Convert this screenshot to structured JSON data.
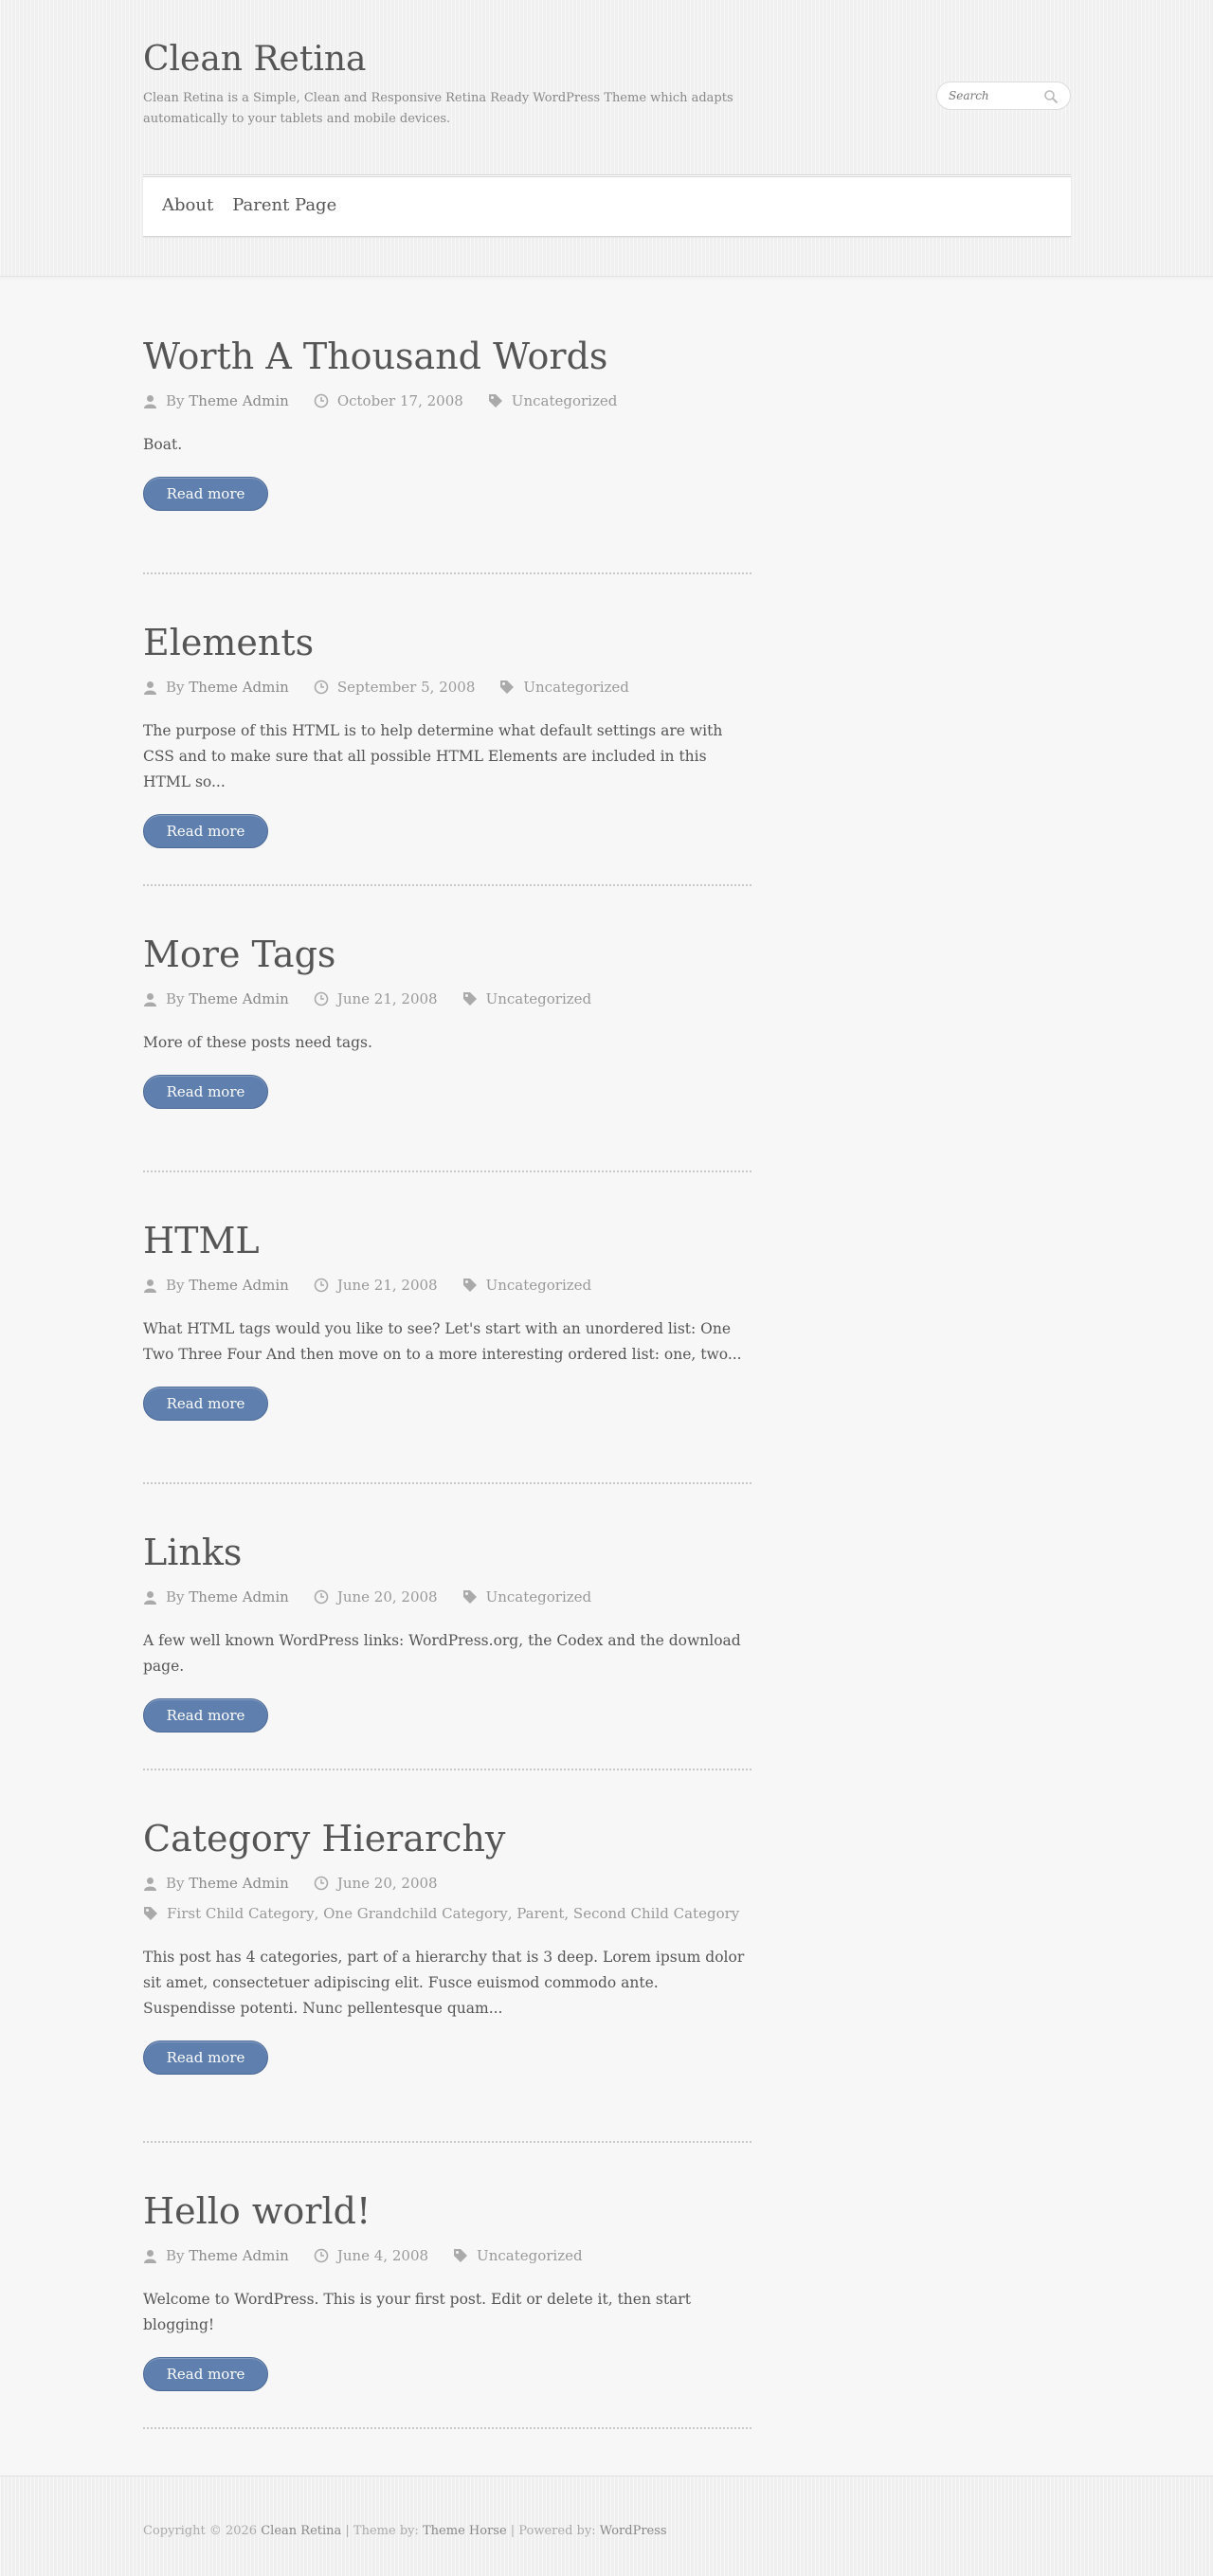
{
  "site": {
    "title": "Clean Retina",
    "description": "Clean Retina is a Simple, Clean and Responsive Retina Ready WordPress Theme which adapts automatically to your tablets and mobile devices."
  },
  "search": {
    "placeholder": "Search"
  },
  "nav": {
    "items": [
      {
        "label": "About"
      },
      {
        "label": "Parent Page"
      }
    ]
  },
  "posts": [
    {
      "title": "Worth A Thousand Words",
      "by": "By",
      "author": "Theme Admin",
      "date": "October 17, 2008",
      "category": "Uncategorized",
      "excerpt": "Boat.",
      "read_more": "Read more"
    },
    {
      "title": "Elements",
      "by": "By",
      "author": "Theme Admin",
      "date": "September 5, 2008",
      "category": "Uncategorized",
      "excerpt": "The purpose of this HTML is to help determine what default settings are with CSS and to make sure that all possible HTML Elements are included in this HTML so...",
      "read_more": "Read more"
    },
    {
      "title": "More Tags",
      "by": "By",
      "author": "Theme Admin",
      "date": "June 21, 2008",
      "category": "Uncategorized",
      "excerpt": "More of these posts need tags.",
      "read_more": "Read more"
    },
    {
      "title": "HTML",
      "by": "By",
      "author": "Theme Admin",
      "date": "June 21, 2008",
      "category": "Uncategorized",
      "excerpt": "What HTML tags would you like to see? Let's start with an unordered list: One Two Three Four And then move on to a more interesting ordered list: one, two...",
      "read_more": "Read more"
    },
    {
      "title": "Links",
      "by": "By",
      "author": "Theme Admin",
      "date": "June 20, 2008",
      "category": "Uncategorized",
      "excerpt": "A few well known WordPress links: WordPress.org, the Codex and the download page.",
      "read_more": "Read more"
    },
    {
      "title": "Category Hierarchy",
      "by": "By",
      "author": "Theme Admin",
      "date": "June 20, 2008",
      "categories": [
        "First Child Category",
        "One Grandchild Category",
        "Parent",
        "Second Child Category"
      ],
      "excerpt": "This post has 4 categories, part of a hierarchy that is 3 deep. Lorem ipsum dolor sit amet, consectetuer adipiscing elit. Fusce euismod commodo ante. Suspendisse potenti. Nunc pellentesque quam...",
      "read_more": "Read more"
    },
    {
      "title": "Hello world!",
      "by": "By",
      "author": "Theme Admin",
      "date": "June 4, 2008",
      "category": "Uncategorized",
      "excerpt": "Welcome to WordPress. This is your first post. Edit or delete it, then start blogging!",
      "read_more": "Read more"
    }
  ],
  "footer": {
    "copyright": "Copyright © 2026",
    "site_link": "Clean Retina",
    "sep1": "| Theme by:",
    "theme_link": "Theme Horse",
    "sep2": "| Powered by:",
    "powered_link": "WordPress"
  },
  "colors": {
    "button": "#5f7fae",
    "background": "#f7f7f7",
    "text": "#555555"
  }
}
